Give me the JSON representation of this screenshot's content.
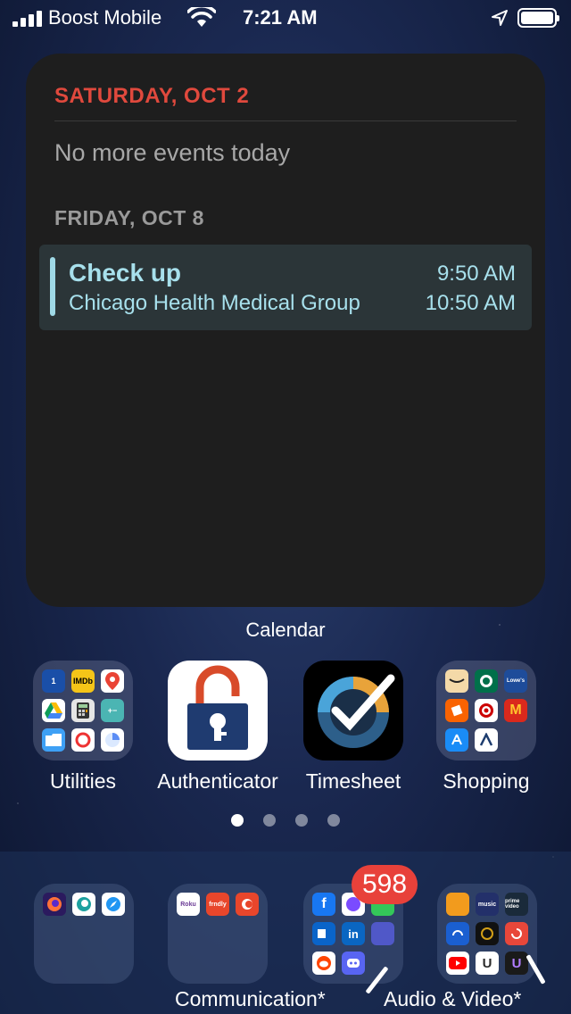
{
  "status_bar": {
    "carrier": "Boost Mobile",
    "time": "7:21 AM"
  },
  "calendar_widget": {
    "today_header": "SATURDAY, OCT 2",
    "no_events_text": "No more events today",
    "next_header": "FRIDAY, OCT 8",
    "event": {
      "title": "Check up",
      "location": "Chicago Health Medical Group",
      "start": "9:50 AM",
      "end": "10:50 AM",
      "color": "#9fd9e6"
    },
    "label": "Calendar"
  },
  "apps": [
    {
      "label": "Utilities",
      "type": "folder"
    },
    {
      "label": "Authenticator",
      "type": "app"
    },
    {
      "label": "Timesheet",
      "type": "app"
    },
    {
      "label": "Shopping",
      "type": "folder"
    }
  ],
  "utilities_folder": [
    "1",
    "IMDb",
    "",
    "",
    "",
    "",
    "",
    "",
    ""
  ],
  "shopping_folder": [
    "",
    "",
    "Lowe's",
    "",
    "",
    "M",
    "",
    "",
    ""
  ],
  "pager": {
    "pages": 4,
    "active": 0
  },
  "dock": {
    "folders": [
      {
        "label": ""
      },
      {
        "label": ""
      },
      {
        "label": "Communication*",
        "badge": "598"
      },
      {
        "label": "Audio & Video*"
      }
    ],
    "browsers_folder": [
      "",
      "",
      ""
    ],
    "tv_folder": [
      "Roku",
      "frndly",
      ""
    ],
    "communication_folder": [
      "f",
      "",
      "",
      "",
      "in",
      "",
      "",
      "",
      ""
    ],
    "audio_video_folder": [
      "",
      "music",
      "prime video",
      "",
      "",
      "",
      "",
      "U",
      "U"
    ]
  },
  "colors": {
    "widget_bg": "#1e1e1e",
    "today_header": "#e0493d",
    "badge": "#e8413a"
  }
}
